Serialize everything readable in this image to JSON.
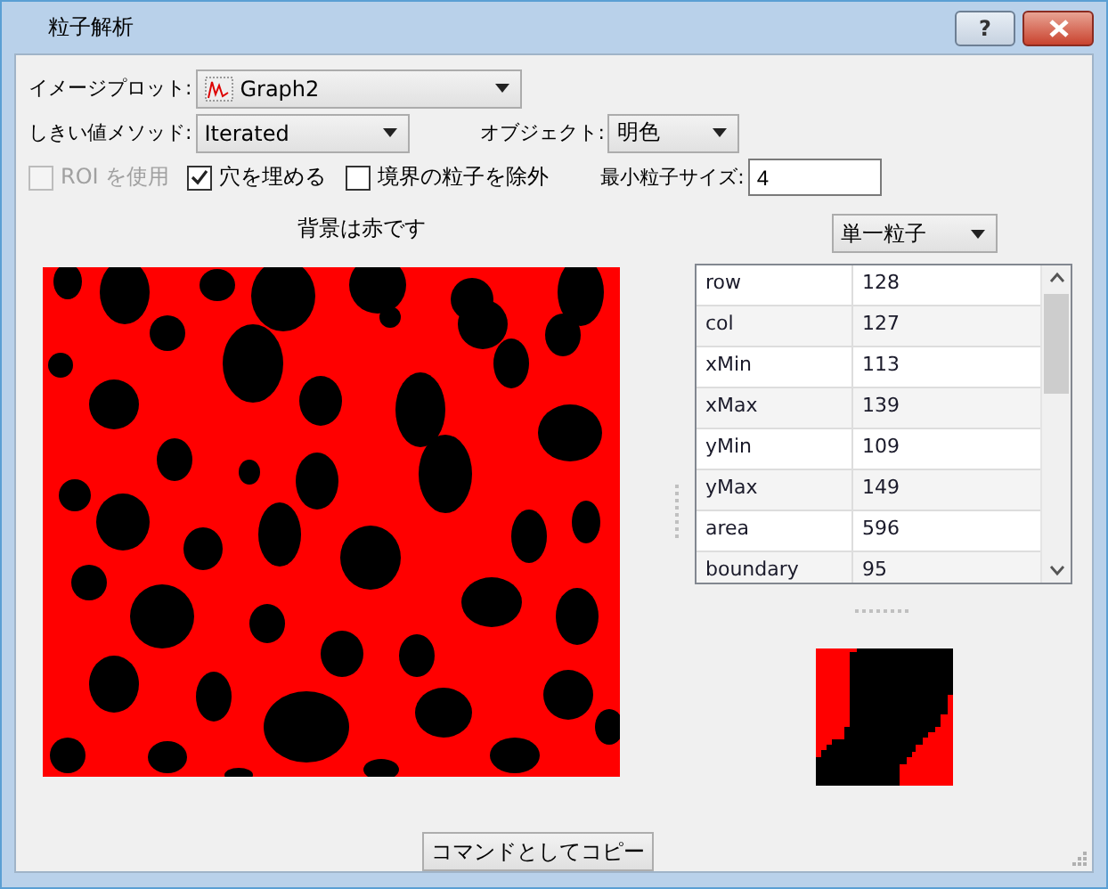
{
  "window": {
    "title": "粒子解析",
    "help_button": "?"
  },
  "image_plot": {
    "label": "イメージプロット:",
    "value": "Graph2"
  },
  "threshold_method": {
    "label": "しきい値メソッド:",
    "value": "Iterated"
  },
  "object": {
    "label": "オブジェクト:",
    "value": "明色"
  },
  "options": [
    {
      "label": "ROI を使用",
      "checked": false,
      "disabled": true
    },
    {
      "label": "穴を埋める",
      "checked": true,
      "disabled": false
    },
    {
      "label": "境界の粒子を除外",
      "checked": false,
      "disabled": false
    }
  ],
  "min_particle_size": {
    "label": "最小粒子サイズ:",
    "value": "4"
  },
  "image_caption": "背景は赤です",
  "particle_mode": "単一粒子",
  "properties": [
    {
      "name": "row",
      "value": "128"
    },
    {
      "name": "col",
      "value": "127"
    },
    {
      "name": "xMin",
      "value": "113"
    },
    {
      "name": "xMax",
      "value": "139"
    },
    {
      "name": "yMin",
      "value": "109"
    },
    {
      "name": "yMax",
      "value": "149"
    },
    {
      "name": "area",
      "value": "596"
    },
    {
      "name": "boundary",
      "value": "95"
    }
  ],
  "copy_button": "コマンドとしてコピー"
}
